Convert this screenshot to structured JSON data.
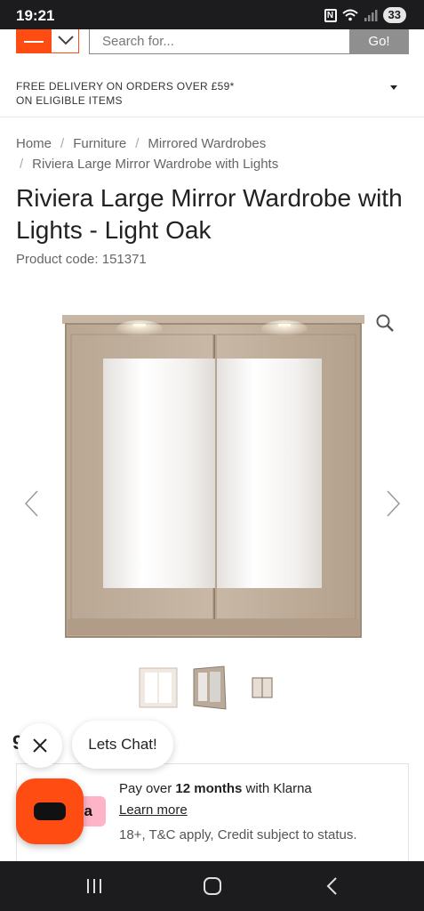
{
  "status_bar": {
    "time": "19:21",
    "nfc": "N",
    "battery": "33"
  },
  "header": {
    "search_placeholder": "Search for...",
    "go_label": "Go!"
  },
  "delivery": {
    "text_line1": "FREE DELIVERY ON ORDERS OVER £59*",
    "text_line2": "ON ELIGIBLE ITEMS"
  },
  "breadcrumb": {
    "items": [
      "Home",
      "Furniture",
      "Mirrored Wardrobes",
      "Riviera Large Mirror Wardrobe with Lights"
    ]
  },
  "product": {
    "title": "Riviera Large Mirror Wardrobe with Lights - Light Oak",
    "code": "Product code: 151371"
  },
  "chat": {
    "label": "Lets Chat!",
    "peek": "9"
  },
  "klarna": {
    "logo_text": "na",
    "line1_prefix": "Pay over ",
    "line1_bold": "12 months",
    "line1_suffix": " with Klarna",
    "learn_more": "Learn more",
    "terms": "18+, T&C apply, Credit subject to status."
  },
  "colors": {
    "brand": "#ff4c12",
    "klarna_pink": "#ffb3c7",
    "bar_bg": "#1c1c1e"
  }
}
